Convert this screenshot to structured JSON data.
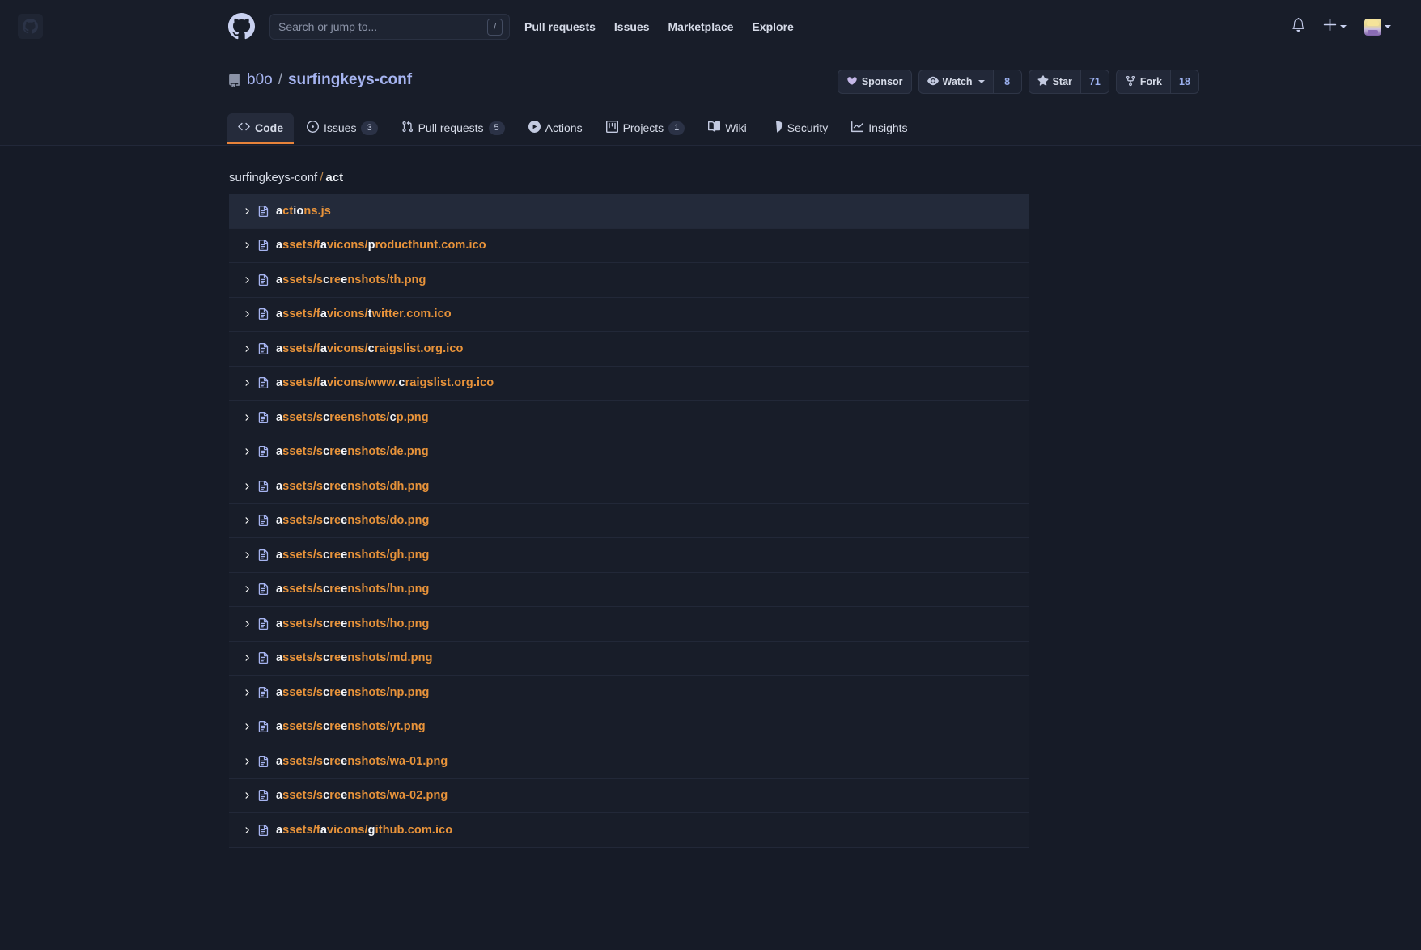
{
  "header": {
    "logo_icon": "github-mark-icon",
    "tile_icon": "github-tile-icon",
    "search": {
      "placeholder": "Search or jump to...",
      "value": "",
      "shortcut_key": "/"
    },
    "nav": [
      {
        "label": "Pull requests",
        "name": "nav-pull-requests"
      },
      {
        "label": "Issues",
        "name": "nav-issues"
      },
      {
        "label": "Marketplace",
        "name": "nav-marketplace"
      },
      {
        "label": "Explore",
        "name": "nav-explore"
      }
    ],
    "right": {
      "notifications_icon": "bell-icon",
      "create_new_icon": "plus-icon",
      "avatar_icon": "user-avatar"
    }
  },
  "repo": {
    "icon": "repo-book-icon",
    "owner": "b0o",
    "separator": "/",
    "name": "surfingkeys-conf",
    "actions": {
      "sponsor": {
        "label": "Sponsor",
        "icon": "heart-icon"
      },
      "watch": {
        "label": "Watch",
        "icon": "eye-icon",
        "count": "8"
      },
      "star": {
        "label": "Star",
        "icon": "star-icon",
        "count": "71"
      },
      "fork": {
        "label": "Fork",
        "icon": "fork-icon",
        "count": "18"
      }
    },
    "tabs": [
      {
        "label": "Code",
        "icon": "code-icon",
        "count": null,
        "active": true
      },
      {
        "label": "Issues",
        "icon": "issue-opened-icon",
        "count": "3",
        "active": false
      },
      {
        "label": "Pull requests",
        "icon": "git-pull-request-icon",
        "count": "5",
        "active": false
      },
      {
        "label": "Actions",
        "icon": "play-icon",
        "count": null,
        "active": false
      },
      {
        "label": "Projects",
        "icon": "project-board-icon",
        "count": "1",
        "active": false
      },
      {
        "label": "Wiki",
        "icon": "book-icon",
        "count": null,
        "active": false
      },
      {
        "label": "Security",
        "icon": "shield-icon",
        "count": null,
        "active": false
      },
      {
        "label": "Insights",
        "icon": "graph-icon",
        "count": null,
        "active": false
      }
    ]
  },
  "omnibar": {
    "breadcrumb": {
      "repo": "surfingkeys-conf",
      "separator": "/",
      "query": "act"
    },
    "selected_index": 0,
    "results": [
      {
        "text": "actions.js",
        "hl": [
          0,
          3,
          4
        ]
      },
      {
        "text": "assets/favicons/producthunt.com.ico",
        "hl": [
          0,
          8,
          16
        ]
      },
      {
        "text": "assets/screenshots/th.png",
        "hl": [
          0,
          8,
          11
        ]
      },
      {
        "text": "assets/favicons/twitter.com.ico",
        "hl": [
          0,
          8,
          16
        ]
      },
      {
        "text": "assets/favicons/craigslist.org.ico",
        "hl": [
          0,
          8,
          16
        ]
      },
      {
        "text": "assets/favicons/www.craigslist.org.ico",
        "hl": [
          0,
          8,
          20
        ]
      },
      {
        "text": "assets/screenshots/cp.png",
        "hl": [
          0,
          8,
          19
        ]
      },
      {
        "text": "assets/screenshots/de.png",
        "hl": [
          0,
          8,
          11
        ]
      },
      {
        "text": "assets/screenshots/dh.png",
        "hl": [
          0,
          8,
          11
        ]
      },
      {
        "text": "assets/screenshots/do.png",
        "hl": [
          0,
          8,
          11
        ]
      },
      {
        "text": "assets/screenshots/gh.png",
        "hl": [
          0,
          8,
          11
        ]
      },
      {
        "text": "assets/screenshots/hn.png",
        "hl": [
          0,
          8,
          11
        ]
      },
      {
        "text": "assets/screenshots/ho.png",
        "hl": [
          0,
          8,
          11
        ]
      },
      {
        "text": "assets/screenshots/md.png",
        "hl": [
          0,
          8,
          11
        ]
      },
      {
        "text": "assets/screenshots/np.png",
        "hl": [
          0,
          8,
          11
        ]
      },
      {
        "text": "assets/screenshots/yt.png",
        "hl": [
          0,
          8,
          11
        ]
      },
      {
        "text": "assets/screenshots/wa-01.png",
        "hl": [
          0,
          8,
          11
        ]
      },
      {
        "text": "assets/screenshots/wa-02.png",
        "hl": [
          0,
          8,
          11
        ]
      },
      {
        "text": "assets/favicons/github.com.ico",
        "hl": [
          0,
          8,
          16
        ]
      }
    ],
    "row_icon": "file-icon",
    "row_chevron": "chevron-right-icon"
  },
  "colors": {
    "page_bg": "#161b27",
    "panel_bg": "#181d29",
    "row_selected": "#232a3a",
    "accent_orange": "#e8933a",
    "link_blue": "#a6b4f0",
    "text_light": "#d6dbe8"
  }
}
